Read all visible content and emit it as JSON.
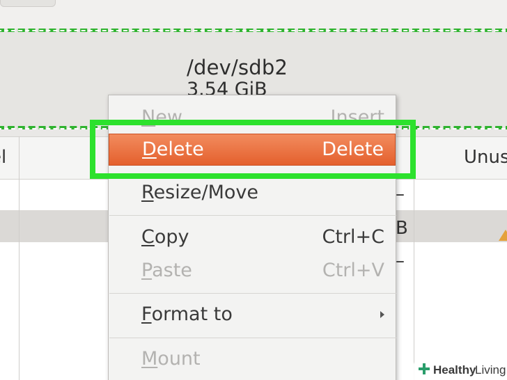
{
  "partition": {
    "device": "/dev/sdb2",
    "size": "3.54 GiB"
  },
  "table": {
    "columns": {
      "label_fragment": "el",
      "unused_fragment": "Unus"
    },
    "cell_fragments": [
      "–",
      "B",
      "–"
    ]
  },
  "context_menu": {
    "items": [
      {
        "mnemonic": "N",
        "rest": "ew",
        "accel": "Insert",
        "enabled": false
      },
      {
        "mnemonic": "D",
        "rest": "elete",
        "accel": "Delete",
        "enabled": true,
        "active": true
      },
      {
        "mnemonic": "R",
        "rest": "esize/Move",
        "accel": "",
        "enabled": true
      },
      {
        "mnemonic": "C",
        "rest": "opy",
        "accel": "Ctrl+C",
        "enabled": true
      },
      {
        "mnemonic": "P",
        "rest": "aste",
        "accel": "Ctrl+V",
        "enabled": false
      },
      {
        "mnemonic": "F",
        "rest": "ormat to",
        "accel": "",
        "enabled": true,
        "submenu": true
      },
      {
        "mnemonic": "M",
        "rest": "ount",
        "accel": "",
        "enabled": false
      }
    ]
  },
  "watermark": {
    "brand_bold": "Healthy",
    "brand_light": "Living"
  },
  "colors": {
    "highlight_green": "#2de12d",
    "dashed_green": "#2fb32f",
    "active_orange": "#e4602d"
  }
}
